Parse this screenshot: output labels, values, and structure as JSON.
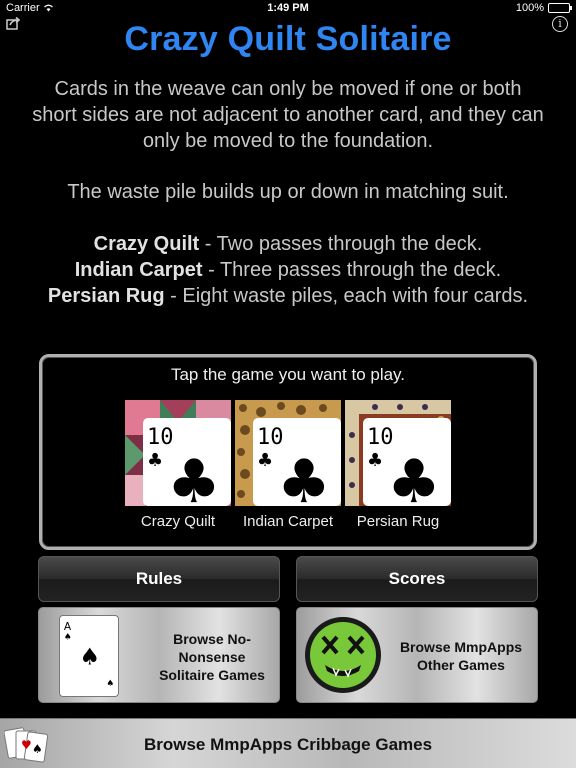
{
  "status_bar": {
    "carrier": "Carrier",
    "time": "1:49 PM",
    "battery": "100%"
  },
  "title": "Crazy Quilt Solitaire",
  "description": {
    "p1": "Cards in the weave can only be moved if one or both short sides are not adjacent to another card, and they can only be moved to the foundation.",
    "p2": "The waste pile builds up or down in matching suit.",
    "variants": [
      {
        "name": "Crazy Quilt",
        "text": " - Two passes through the deck."
      },
      {
        "name": "Indian Carpet",
        "text": " - Three passes through the deck."
      },
      {
        "name": "Persian Rug",
        "text": " - Eight waste piles, each with four cards."
      }
    ]
  },
  "picker": {
    "prompt": "Tap the game you want to play.",
    "games": [
      {
        "label": "Crazy Quilt",
        "card_rank": "10",
        "card_suit": "♣"
      },
      {
        "label": "Indian Carpet",
        "card_rank": "10",
        "card_suit": "♣"
      },
      {
        "label": "Persian Rug",
        "card_rank": "10",
        "card_suit": "♣"
      }
    ]
  },
  "buttons": {
    "rules": "Rules",
    "scores": "Scores",
    "browse_nonsense": "Browse No-Nonsense Solitaire Games",
    "browse_other": "Browse MmpApps Other Games",
    "browse_cribbage": "Browse MmpApps Cribbage Games"
  },
  "ace_card": {
    "rank": "A",
    "suit": "♠"
  },
  "icons": {
    "share": "share-icon",
    "info": "info-icon",
    "wifi": "wifi-icon"
  },
  "colors": {
    "title": "#2f86f2",
    "background": "#000000"
  }
}
